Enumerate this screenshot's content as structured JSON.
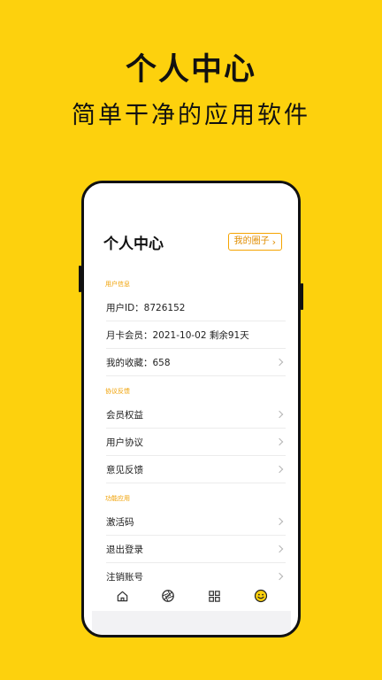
{
  "hero": {
    "title": "个人中心",
    "subtitle": "简单干净的应用软件"
  },
  "header": {
    "title": "个人中心",
    "circle_button_label": "我的圈子"
  },
  "sections": [
    {
      "title": "用户信息",
      "rows": [
        {
          "label": "用户ID：8726152"
        },
        {
          "label": "月卡会员：2021-10-02 剩余91天"
        },
        {
          "label": "我的收藏：658"
        }
      ]
    },
    {
      "title": "协议反馈",
      "rows": [
        {
          "label": "会员权益"
        },
        {
          "label": "用户协议"
        },
        {
          "label": "意见反馈"
        }
      ]
    },
    {
      "title": "功能应用",
      "rows": [
        {
          "label": "激活码"
        },
        {
          "label": "退出登录"
        },
        {
          "label": "注销账号"
        }
      ]
    }
  ],
  "tabbar": {
    "items": [
      {
        "icon": "home-icon"
      },
      {
        "icon": "aperture-icon"
      },
      {
        "icon": "grid-icon"
      },
      {
        "icon": "smiley-icon",
        "active": true
      }
    ],
    "active_color": "#F5B800",
    "inactive_color": "#333333"
  },
  "colors": {
    "background": "#FDD10D",
    "accent": "#F5A400"
  }
}
